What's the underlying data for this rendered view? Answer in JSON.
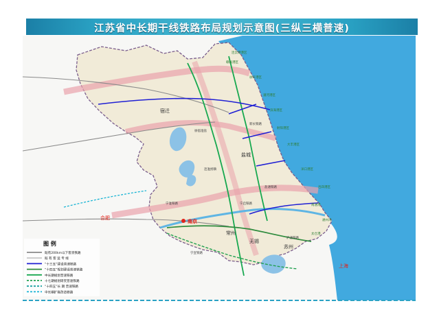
{
  "title": "江苏省中长期干线铁路布局规划示意图(三纵三横普速)",
  "legend": {
    "title": "图 例",
    "items": [
      {
        "label": "既有200km以下客货铁路",
        "color": "#8a8a8a",
        "style": "solid"
      },
      {
        "label": "既 有 客 运 专 线",
        "color": "#c9c9c9",
        "style": "solid"
      },
      {
        "label": "“十三五”建设普速铁路",
        "color": "#1f1fd4",
        "style": "solid"
      },
      {
        "label": "“十四五”规划建设普速铁路",
        "color": "#2e8b3d",
        "style": "solid"
      },
      {
        "label": "中长期规划普速铁路",
        "color": "#17a84f",
        "style": "solid"
      },
      {
        "label": "十七期规划研究普速铁路",
        "color": "#20a050",
        "style": "dashed"
      },
      {
        "label": "“十四五”长 期 普速铁路",
        "color": "#1aa0a0",
        "style": "dashed"
      },
      {
        "label": "中长期扩能改造铁路",
        "color": "#18b4d4",
        "style": "dashed"
      }
    ]
  },
  "places": [
    {
      "name": "宿迁",
      "kind": "city"
    },
    {
      "name": "盐城",
      "kind": "city"
    },
    {
      "name": "南京",
      "kind": "capital"
    },
    {
      "name": "合肥",
      "kind": "outside-city"
    },
    {
      "name": "上海",
      "kind": "outside-city"
    },
    {
      "name": "苏州",
      "kind": "city"
    },
    {
      "name": "无锡",
      "kind": "city"
    },
    {
      "name": "常州",
      "kind": "city"
    }
  ],
  "small_labels": [
    "连云港港区",
    "赣榆港区",
    "徐圩港区",
    "灌河港区",
    "滨海港区",
    "射阳港区",
    "大丰港区",
    "洋口港区",
    "吕四港区",
    "南通港",
    "通州湾",
    "太仓港",
    "沪通铁路",
    "盐通铁路",
    "宁启铁路",
    "新长铁路",
    "连淮扬镇",
    "徐宿淮盐",
    "宁淮铁路",
    "宁宣铁路"
  ],
  "colors": {
    "sea": "#41a9df",
    "land": "#f1ebd8",
    "outside_land": "#f7f7f5",
    "lake": "#8cc2e6",
    "corridor": "#e9a3ac",
    "boundary": "#7a5d8c",
    "title_bg": "#2aa2c4",
    "capital_marker": "#e2231a"
  }
}
